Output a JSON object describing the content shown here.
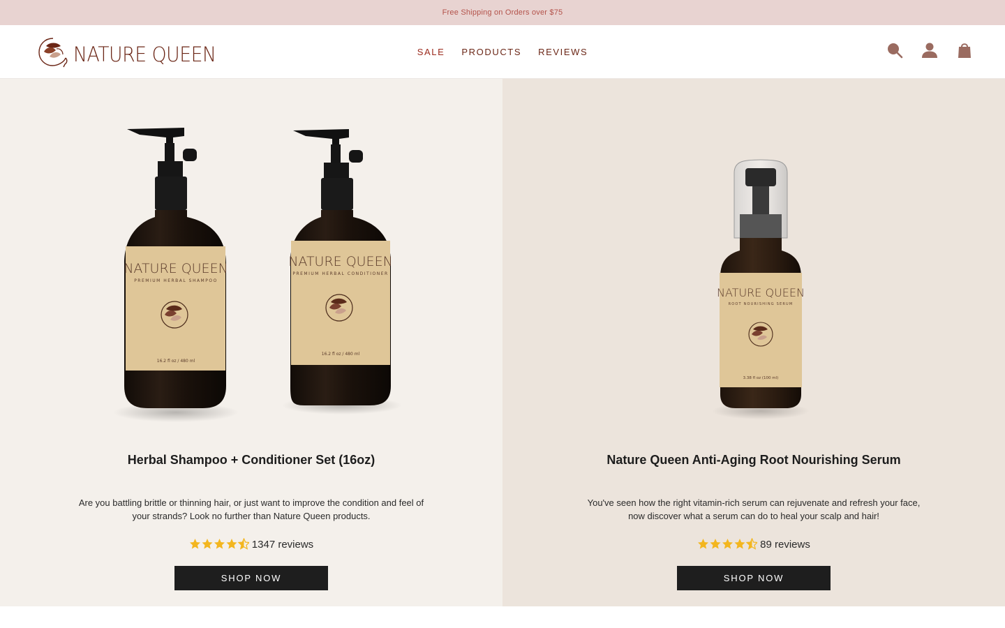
{
  "announcement": "Free Shipping on Orders over $75",
  "brand": {
    "name": "NATURE QUEEN"
  },
  "nav": {
    "sale": "SALE",
    "products": "PRODUCTS",
    "reviews": "REVIEWS"
  },
  "header_icons": [
    "search-icon",
    "account-icon",
    "cart-icon"
  ],
  "colors": {
    "accent": "#9b2a1c",
    "brand": "#6b2616",
    "announce_bg": "#e8d3d1",
    "star": "#f3b61f",
    "button": "#1e1e1e"
  },
  "products": [
    {
      "title": "Herbal Shampoo + Conditioner Set (16oz)",
      "description": "Are you battling brittle or thinning hair, or just want to improve the condition and feel of your strands? Look no further than Nature Queen products.",
      "rating": 4.5,
      "reviews": "1347 reviews",
      "cta": "SHOP NOW",
      "labels": {
        "bottle1_brand": "NATURE QUEEN",
        "bottle1_sub": "PREMIUM HERBAL SHAMPOO",
        "bottle1_vol": "16.2 fl oz / 480 ml",
        "bottle2_brand": "NATURE QUEEN",
        "bottle2_sub": "PREMIUM HERBAL CONDITIONER",
        "bottle2_vol": "16.2 fl oz / 480 ml"
      }
    },
    {
      "title": "Nature Queen Anti-Aging Root Nourishing Serum",
      "description": "You've seen how the right vitamin-rich serum can rejuvenate and refresh your face, now discover what a serum can do to heal your scalp and hair!",
      "rating": 4.5,
      "reviews": "89 reviews",
      "cta": "SHOP NOW",
      "labels": {
        "bottle_brand": "NATURE QUEEN",
        "bottle_sub": "ROOT NOURISHING SERUM",
        "bottle_vol": "3.38 fl oz (100 ml)"
      }
    }
  ]
}
